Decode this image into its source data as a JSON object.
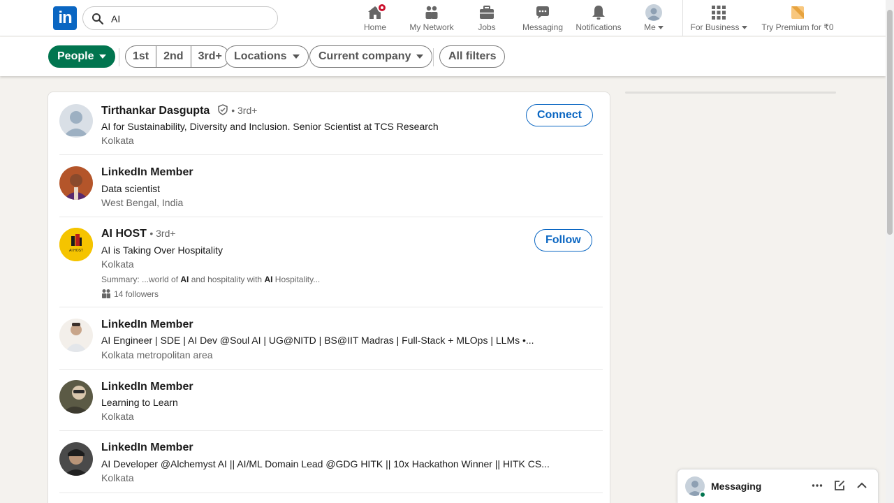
{
  "nav": {
    "logo_text": "in",
    "search_value": "AI",
    "items": [
      {
        "label": "Home",
        "icon": "home-icon"
      },
      {
        "label": "My Network",
        "icon": "network-icon"
      },
      {
        "label": "Jobs",
        "icon": "briefcase-icon"
      },
      {
        "label": "Messaging",
        "icon": "chat-icon"
      },
      {
        "label": "Notifications",
        "icon": "bell-icon"
      },
      {
        "label": "Me",
        "icon": "avatar"
      },
      {
        "label": "For Business",
        "icon": "grid-icon"
      },
      {
        "label": "Try Premium for ₹0",
        "icon": "premium-icon"
      }
    ]
  },
  "filters": {
    "people": "People",
    "degrees": [
      "1st",
      "2nd",
      "3rd+"
    ],
    "locations": "Locations",
    "current_company": "Current company",
    "all_filters": "All filters"
  },
  "results": [
    {
      "name": "Tirthankar Dasgupta",
      "verified": true,
      "degree": "• 3rd+",
      "headline": "AI for Sustainability, Diversity and Inclusion. Senior Scientist at TCS Research",
      "location": "Kolkata",
      "action": "Connect"
    },
    {
      "name": "LinkedIn Member",
      "headline": "Data scientist",
      "location": "West Bengal, India"
    },
    {
      "name": "AI HOST",
      "degree": "• 3rd+",
      "headline": "AI is Taking Over Hospitality",
      "location": "Kolkata",
      "summary_prefix": "Summary: ...world of ",
      "summary_bold1": "AI",
      "summary_mid": " and hospitality with ",
      "summary_bold2": "AI",
      "summary_suffix": " Hospitality...",
      "followers": "14 followers",
      "action": "Follow",
      "logo_text": "AI HOST"
    },
    {
      "name": "LinkedIn Member",
      "headline": "AI Engineer | SDE | AI Dev @Soul AI | UG@NITD | BS@IIT Madras | Full-Stack + MLOps | LLMs •...",
      "location": "Kolkata metropolitan area"
    },
    {
      "name": "LinkedIn Member",
      "headline": "Learning to Learn",
      "location": "Kolkata"
    },
    {
      "name": "LinkedIn Member",
      "headline": "AI Developer @Alchemyst AI || AI/ML Domain Lead @GDG HITK || 10x Hackathon Winner || HITK CS...",
      "location": "Kolkata"
    }
  ],
  "messaging": {
    "label": "Messaging"
  },
  "colors": {
    "brand": "#0a66c2",
    "active_filter": "#01754f",
    "notification_badge": "#cb112d"
  }
}
